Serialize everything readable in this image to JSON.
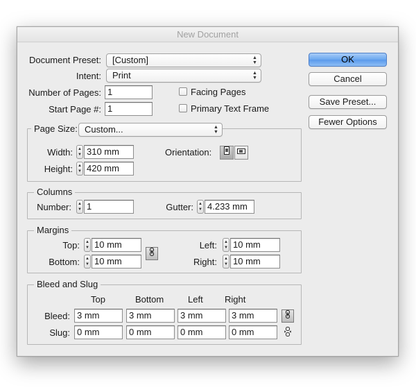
{
  "window": {
    "title": "New Document"
  },
  "document_preset": {
    "label": "Document Preset:",
    "value": "[Custom]"
  },
  "intent": {
    "label": "Intent:",
    "value": "Print"
  },
  "number_of_pages": {
    "label": "Number of Pages:",
    "value": "1"
  },
  "start_page": {
    "label": "Start Page #:",
    "value": "1"
  },
  "facing_pages": {
    "label": "Facing Pages",
    "checked": false
  },
  "primary_text_frame": {
    "label": "Primary Text Frame",
    "checked": false
  },
  "page_size": {
    "label": "Page Size:",
    "value": "Custom...",
    "width_label": "Width:",
    "width": "310 mm",
    "height_label": "Height:",
    "height": "420 mm",
    "orientation_label": "Orientation:",
    "orientation": "portrait"
  },
  "columns": {
    "title": "Columns",
    "number_label": "Number:",
    "number": "1",
    "gutter_label": "Gutter:",
    "gutter": "4.233 mm"
  },
  "margins": {
    "title": "Margins",
    "top_label": "Top:",
    "top": "10 mm",
    "bottom_label": "Bottom:",
    "bottom": "10 mm",
    "left_label": "Left:",
    "left": "10 mm",
    "right_label": "Right:",
    "right": "10 mm",
    "linked": true
  },
  "bleed_slug": {
    "title": "Bleed and Slug",
    "headers": [
      "Top",
      "Bottom",
      "Left",
      "Right"
    ],
    "bleed_label": "Bleed:",
    "bleed": [
      "3 mm",
      "3 mm",
      "3 mm",
      "3 mm"
    ],
    "slug_label": "Slug:",
    "slug": [
      "0 mm",
      "0 mm",
      "0 mm",
      "0 mm"
    ],
    "bleed_linked": true,
    "slug_linked": false
  },
  "buttons": {
    "ok": "OK",
    "cancel": "Cancel",
    "save_preset": "Save Preset...",
    "fewer_options": "Fewer Options"
  },
  "icons": {
    "select_arrows": "▲▼",
    "stepper": "▲▼",
    "chain_link": "chain-link-icon",
    "portrait": "portrait-orientation-icon",
    "landscape": "landscape-orientation-icon"
  }
}
